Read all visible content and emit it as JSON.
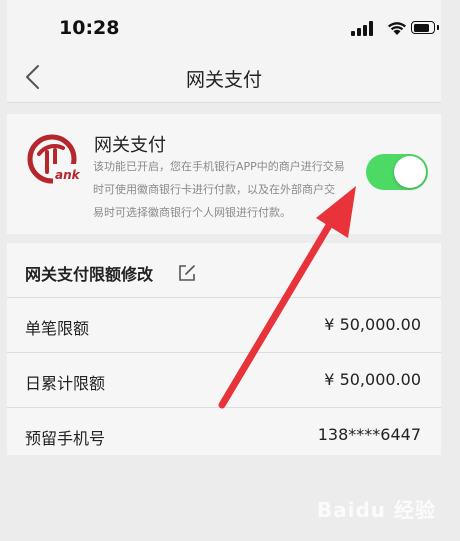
{
  "status_bar": {
    "time": "10:28",
    "icons": [
      "signal-icon",
      "wifi-icon",
      "battery-icon"
    ],
    "battery_level": 0.85
  },
  "nav": {
    "back_icon": "chevron-left-icon",
    "title": "网关支付"
  },
  "gateway": {
    "logo_text": "ank",
    "title": "网关支付",
    "description": "该功能已开启，您在手机银行APP中的商户进行交易时可使用徽商银行卡进行付款，以及在外部商户交易时可选择徽商银行个人网银进行付款。",
    "toggle_on": true
  },
  "limits": {
    "title": "网关支付限额修改",
    "edit_icon": "edit-icon",
    "rows": [
      {
        "label": "单笔限额",
        "value": "¥ 50,000.00"
      },
      {
        "label": "日累计限额",
        "value": "¥ 50,000.00"
      },
      {
        "label": "预留手机号",
        "value": "138****6447"
      }
    ]
  },
  "watermark": "Baidu 经验",
  "colors": {
    "toggle_on": "#4cd964",
    "arrow": "#e8333b",
    "logo": "#b5272d",
    "background": "#ececec",
    "card": "#f6f6f6"
  }
}
